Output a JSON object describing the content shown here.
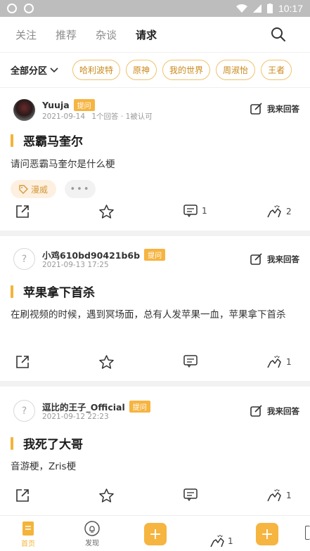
{
  "status_bar": {
    "time": "10:17"
  },
  "tabs": [
    {
      "label": "关注"
    },
    {
      "label": "推荐"
    },
    {
      "label": "杂谈"
    },
    {
      "label": "请求"
    }
  ],
  "filter": {
    "all_label": "全部分区",
    "chips": [
      "哈利波特",
      "原神",
      "我的世界",
      "周淑怡",
      "王者"
    ]
  },
  "posts": [
    {
      "user": "Yuuja",
      "badge": "提问",
      "date": "2021-09-14",
      "stats": "1个回答 · 1被认可",
      "answer_label": "我来回答",
      "title": "恶霸马奎尔",
      "body": "请问恶霸马奎尔是什么梗",
      "tag": "漫威",
      "comment_count": "1",
      "like_count": "2"
    },
    {
      "user": "小鸡610bd90421b6b",
      "badge": "提问",
      "date": "2021-09-13 17:25",
      "answer_label": "我来回答",
      "title": "苹果拿下首杀",
      "body": "在刷视频的时候，遇到冥场面，总有人发苹果一血，苹果拿下首杀",
      "comment_count": "",
      "like_count": "1"
    },
    {
      "user": "逗比的王子_Official",
      "badge": "提问",
      "date": "2021-09-12 22:23",
      "answer_label": "我来回答",
      "title": "我死了大哥",
      "body": "音游梗，Zris梗",
      "comment_count": "",
      "like_count": "1"
    }
  ],
  "bottom_nav": {
    "home": "首页",
    "discover": "发现",
    "like_count": "1"
  }
}
